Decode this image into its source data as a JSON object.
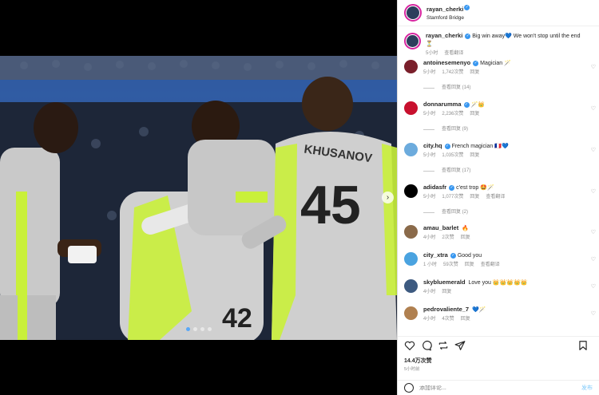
{
  "post": {
    "username": "rayan_cherki",
    "location": "Stamford Bridge",
    "caption": "Big win away💙 We won't stop until the end⏳",
    "caption_time": "5小时",
    "caption_translate": "查看翻译",
    "likes": "14.4万次赞",
    "posted_ago": "5小时前"
  },
  "photo": {
    "jersey_numbers": [
      "45",
      "42"
    ],
    "jersey_name": "KHUSANOV",
    "slide_count": 4,
    "active_slide": 1
  },
  "comments": [
    {
      "user": "antoinesemenyo",
      "text": "Magician 🪄",
      "time": "5小时",
      "likes": "1,742次赞",
      "reply": "回复",
      "replies": "查看回复 (14)",
      "avatar_color": "#7a1f2b"
    },
    {
      "user": "donnarumma",
      "text": "🪄👑",
      "time": "5小时",
      "likes": "2,236次赞",
      "reply": "回复",
      "replies": "查看回复 (9)",
      "avatar_color": "#c8102e"
    },
    {
      "user": "city.hq",
      "text": "French magician 🇫🇷💙",
      "time": "5小时",
      "likes": "1,035次赞",
      "reply": "回复",
      "replies": "查看回复 (17)",
      "avatar_color": "#6cabdd"
    },
    {
      "user": "adidasfr",
      "text": "c'est trop 🤩🪄",
      "time": "5小时",
      "likes": "1,077次赞",
      "reply": "回复",
      "translate": "查看翻译",
      "replies": "查看回复 (2)",
      "avatar_color": "#000000"
    },
    {
      "user": "amau_barlet",
      "text": "🔥",
      "time": "4小时",
      "likes": "2次赞",
      "reply": "回复",
      "avatar_color": "#8a6a4a"
    },
    {
      "user": "city_xtra",
      "text": "Good you",
      "time": "1 小时",
      "likes": "59次赞",
      "reply": "回复",
      "translate": "查看翻译",
      "avatar_color": "#4aa3e0"
    },
    {
      "user": "skybluemerald",
      "text": "Love you 👑👑👑👑👑",
      "time": "4小时",
      "likes": "",
      "reply": "回复",
      "avatar_color": "#3d5a80"
    },
    {
      "user": "pedrovaliente_7",
      "text": "💙🪄",
      "time": "4小时",
      "likes": "4次赞",
      "reply": "回复",
      "avatar_color": "#b08050"
    }
  ],
  "compose": {
    "placeholder": "添加评论...",
    "post_label": "发布"
  },
  "colors": {
    "accent": "#0095f6",
    "verified": "#3897f0",
    "kit_grey": "#c9c9c9",
    "kit_neon": "#c9f03a"
  }
}
